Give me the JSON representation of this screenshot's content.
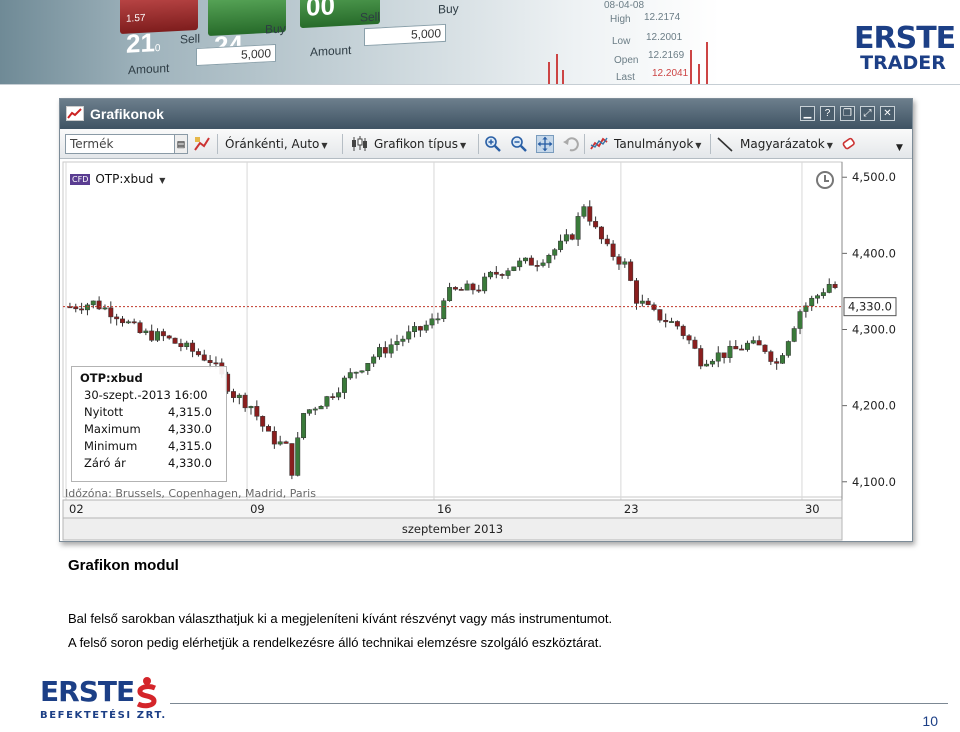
{
  "banner": {
    "tiles": [
      {
        "small": "1.57",
        "big": "21",
        "sup": "0",
        "side": "sell"
      },
      {
        "small": "",
        "big": "24",
        "sup": "0",
        "side": "buy"
      },
      {
        "small": "",
        "big": "00",
        "sup": "",
        "side": "buy"
      }
    ],
    "sell_label": "Sell",
    "buy_label": "Buy",
    "amount_label": "Amount",
    "amount_value": "5,000",
    "stats": [
      {
        "label": "High",
        "value": "12.2174"
      },
      {
        "label": "Low",
        "value": "12.2001"
      },
      {
        "label": "Open",
        "value": "12.2169"
      },
      {
        "label": "Last",
        "value": "12.2041"
      }
    ],
    "date_fragment": "08-04-08",
    "logo_line1": "ERSTE",
    "logo_line2": "TRADER"
  },
  "window": {
    "title": "Grafikonok",
    "toolbar": {
      "product_placeholder": "Termék",
      "interval_label": "Óránkénti,",
      "auto_label": "Auto",
      "chart_type_label": "Grafikon típus",
      "studies_label": "Tanulmányok",
      "annotations_label": "Magyarázatok"
    },
    "symbol": "OTP:xbud",
    "cfd_badge": "CFD",
    "info": {
      "title": "OTP:xbud",
      "datetime": "30-szept.-2013 16:00",
      "rows": [
        {
          "label": "Nyitott",
          "value": "4,315.0"
        },
        {
          "label": "Maximum",
          "value": "4,330.0"
        },
        {
          "label": "Minimum",
          "value": "4,315.0"
        },
        {
          "label": "Záró ár",
          "value": "4,330.0"
        }
      ]
    },
    "timezone": "Időzóna: Brussels, Copenhagen, Madrid, Paris"
  },
  "chart_data": {
    "type": "candlestick",
    "ylim": [
      4080,
      4520
    ],
    "y_ticks": [
      "4,500.0",
      "4,400.0",
      "4,300.0",
      "4,200.0",
      "4,100.0"
    ],
    "y_tick_values": [
      4500,
      4400,
      4300,
      4200,
      4100
    ],
    "x_ticks": [
      "02",
      "09",
      "16",
      "23",
      "30"
    ],
    "x_tick_index": [
      0,
      31,
      63,
      95,
      126
    ],
    "xlabel": "szeptember 2013",
    "last_price_label": "4,330.0",
    "last_price": 4330,
    "candle_count": 132,
    "bull_color": "#3a7a3a",
    "bear_color": "#8a1e1e",
    "close_path": [
      [
        0,
        4330
      ],
      [
        4,
        4335
      ],
      [
        8,
        4320
      ],
      [
        12,
        4295
      ],
      [
        16,
        4290
      ],
      [
        20,
        4275
      ],
      [
        24,
        4260
      ],
      [
        28,
        4215
      ],
      [
        31,
        4200
      ],
      [
        34,
        4160
      ],
      [
        37,
        4145
      ],
      [
        38,
        4115
      ],
      [
        40,
        4190
      ],
      [
        44,
        4210
      ],
      [
        48,
        4240
      ],
      [
        52,
        4265
      ],
      [
        56,
        4285
      ],
      [
        60,
        4300
      ],
      [
        63,
        4315
      ],
      [
        64,
        4345
      ],
      [
        66,
        4350
      ],
      [
        70,
        4355
      ],
      [
        72,
        4370
      ],
      [
        76,
        4385
      ],
      [
        80,
        4390
      ],
      [
        84,
        4410
      ],
      [
        86,
        4425
      ],
      [
        88,
        4465
      ],
      [
        90,
        4430
      ],
      [
        92,
        4405
      ],
      [
        95,
        4385
      ],
      [
        97,
        4340
      ],
      [
        100,
        4320
      ],
      [
        104,
        4305
      ],
      [
        106,
        4285
      ],
      [
        108,
        4260
      ],
      [
        110,
        4265
      ],
      [
        113,
        4270
      ],
      [
        116,
        4280
      ],
      [
        119,
        4275
      ],
      [
        121,
        4255
      ],
      [
        123,
        4290
      ],
      [
        125,
        4325
      ],
      [
        128,
        4345
      ],
      [
        130,
        4360
      ],
      [
        131,
        4355
      ],
      [
        132,
        4310
      ],
      [
        134,
        4305
      ],
      [
        136,
        4330
      ]
    ]
  },
  "slide": {
    "title": "Grafikon modul",
    "para1": "Bal felső sarokban választhatjuk ki a megjeleníteni kívánt részvényt vagy más instrumentumot.",
    "para2": "A felső soron pedig elérhetjük a rendelkezésre álló technikai elemzésre szolgáló eszköztárat.",
    "footer_logo_line1": "ERSTE",
    "footer_logo_line2": "BEFEKTETÉSI ZRT.",
    "page_number": "10"
  }
}
